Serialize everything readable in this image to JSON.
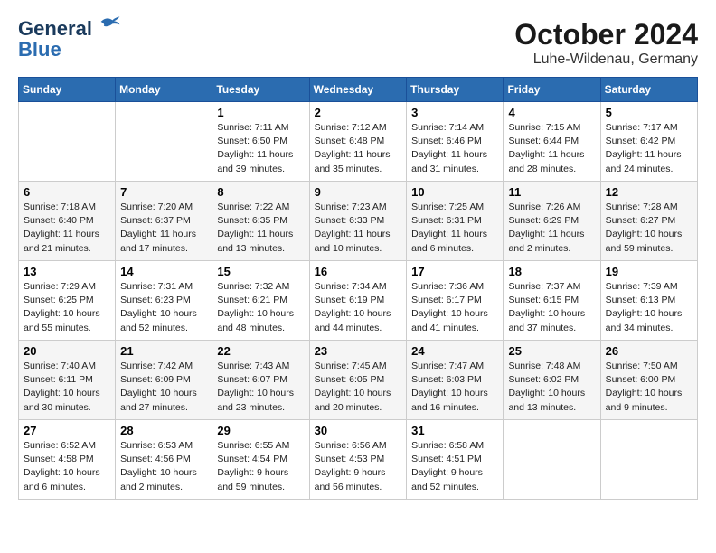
{
  "logo": {
    "line1": "General",
    "line2": "Blue"
  },
  "title": "October 2024",
  "location": "Luhe-Wildenau, Germany",
  "days_header": [
    "Sunday",
    "Monday",
    "Tuesday",
    "Wednesday",
    "Thursday",
    "Friday",
    "Saturday"
  ],
  "weeks": [
    [
      {
        "day": "",
        "info": ""
      },
      {
        "day": "",
        "info": ""
      },
      {
        "day": "1",
        "info": "Sunrise: 7:11 AM\nSunset: 6:50 PM\nDaylight: 11 hours and 39 minutes."
      },
      {
        "day": "2",
        "info": "Sunrise: 7:12 AM\nSunset: 6:48 PM\nDaylight: 11 hours and 35 minutes."
      },
      {
        "day": "3",
        "info": "Sunrise: 7:14 AM\nSunset: 6:46 PM\nDaylight: 11 hours and 31 minutes."
      },
      {
        "day": "4",
        "info": "Sunrise: 7:15 AM\nSunset: 6:44 PM\nDaylight: 11 hours and 28 minutes."
      },
      {
        "day": "5",
        "info": "Sunrise: 7:17 AM\nSunset: 6:42 PM\nDaylight: 11 hours and 24 minutes."
      }
    ],
    [
      {
        "day": "6",
        "info": "Sunrise: 7:18 AM\nSunset: 6:40 PM\nDaylight: 11 hours and 21 minutes."
      },
      {
        "day": "7",
        "info": "Sunrise: 7:20 AM\nSunset: 6:37 PM\nDaylight: 11 hours and 17 minutes."
      },
      {
        "day": "8",
        "info": "Sunrise: 7:22 AM\nSunset: 6:35 PM\nDaylight: 11 hours and 13 minutes."
      },
      {
        "day": "9",
        "info": "Sunrise: 7:23 AM\nSunset: 6:33 PM\nDaylight: 11 hours and 10 minutes."
      },
      {
        "day": "10",
        "info": "Sunrise: 7:25 AM\nSunset: 6:31 PM\nDaylight: 11 hours and 6 minutes."
      },
      {
        "day": "11",
        "info": "Sunrise: 7:26 AM\nSunset: 6:29 PM\nDaylight: 11 hours and 2 minutes."
      },
      {
        "day": "12",
        "info": "Sunrise: 7:28 AM\nSunset: 6:27 PM\nDaylight: 10 hours and 59 minutes."
      }
    ],
    [
      {
        "day": "13",
        "info": "Sunrise: 7:29 AM\nSunset: 6:25 PM\nDaylight: 10 hours and 55 minutes."
      },
      {
        "day": "14",
        "info": "Sunrise: 7:31 AM\nSunset: 6:23 PM\nDaylight: 10 hours and 52 minutes."
      },
      {
        "day": "15",
        "info": "Sunrise: 7:32 AM\nSunset: 6:21 PM\nDaylight: 10 hours and 48 minutes."
      },
      {
        "day": "16",
        "info": "Sunrise: 7:34 AM\nSunset: 6:19 PM\nDaylight: 10 hours and 44 minutes."
      },
      {
        "day": "17",
        "info": "Sunrise: 7:36 AM\nSunset: 6:17 PM\nDaylight: 10 hours and 41 minutes."
      },
      {
        "day": "18",
        "info": "Sunrise: 7:37 AM\nSunset: 6:15 PM\nDaylight: 10 hours and 37 minutes."
      },
      {
        "day": "19",
        "info": "Sunrise: 7:39 AM\nSunset: 6:13 PM\nDaylight: 10 hours and 34 minutes."
      }
    ],
    [
      {
        "day": "20",
        "info": "Sunrise: 7:40 AM\nSunset: 6:11 PM\nDaylight: 10 hours and 30 minutes."
      },
      {
        "day": "21",
        "info": "Sunrise: 7:42 AM\nSunset: 6:09 PM\nDaylight: 10 hours and 27 minutes."
      },
      {
        "day": "22",
        "info": "Sunrise: 7:43 AM\nSunset: 6:07 PM\nDaylight: 10 hours and 23 minutes."
      },
      {
        "day": "23",
        "info": "Sunrise: 7:45 AM\nSunset: 6:05 PM\nDaylight: 10 hours and 20 minutes."
      },
      {
        "day": "24",
        "info": "Sunrise: 7:47 AM\nSunset: 6:03 PM\nDaylight: 10 hours and 16 minutes."
      },
      {
        "day": "25",
        "info": "Sunrise: 7:48 AM\nSunset: 6:02 PM\nDaylight: 10 hours and 13 minutes."
      },
      {
        "day": "26",
        "info": "Sunrise: 7:50 AM\nSunset: 6:00 PM\nDaylight: 10 hours and 9 minutes."
      }
    ],
    [
      {
        "day": "27",
        "info": "Sunrise: 6:52 AM\nSunset: 4:58 PM\nDaylight: 10 hours and 6 minutes."
      },
      {
        "day": "28",
        "info": "Sunrise: 6:53 AM\nSunset: 4:56 PM\nDaylight: 10 hours and 2 minutes."
      },
      {
        "day": "29",
        "info": "Sunrise: 6:55 AM\nSunset: 4:54 PM\nDaylight: 9 hours and 59 minutes."
      },
      {
        "day": "30",
        "info": "Sunrise: 6:56 AM\nSunset: 4:53 PM\nDaylight: 9 hours and 56 minutes."
      },
      {
        "day": "31",
        "info": "Sunrise: 6:58 AM\nSunset: 4:51 PM\nDaylight: 9 hours and 52 minutes."
      },
      {
        "day": "",
        "info": ""
      },
      {
        "day": "",
        "info": ""
      }
    ]
  ]
}
